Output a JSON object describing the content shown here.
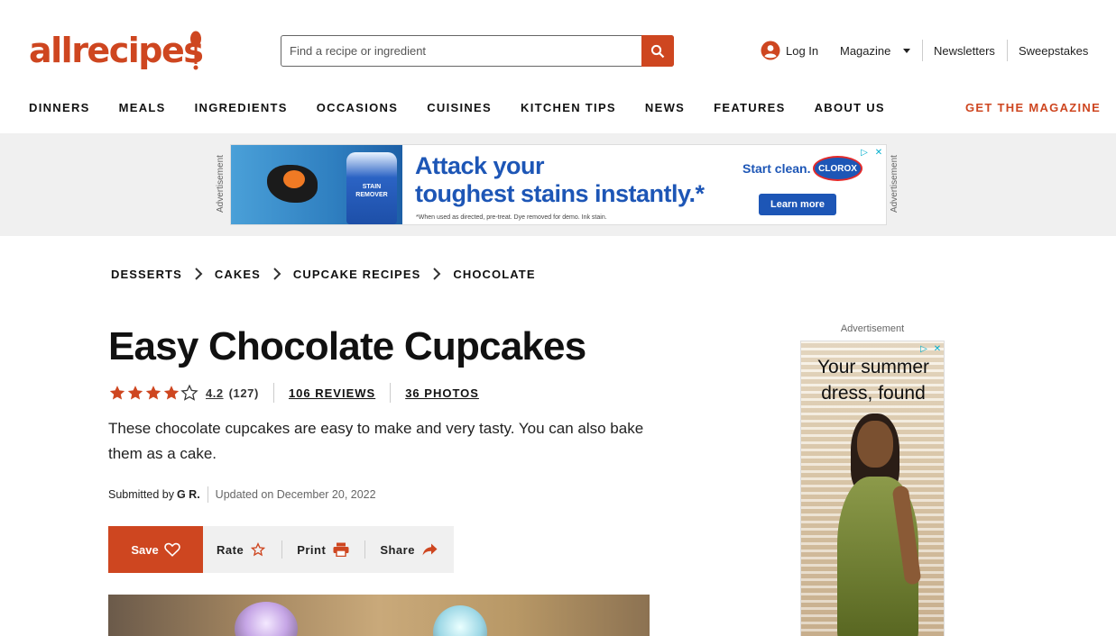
{
  "header": {
    "logo": "allrecipes",
    "search_placeholder": "Find a recipe or ingredient",
    "login": "Log In",
    "magazine": "Magazine",
    "newsletters": "Newsletters",
    "sweepstakes": "Sweepstakes",
    "get_magazine": "GET THE MAGAZINE",
    "accent_color": "#ce4620"
  },
  "nav": [
    "DINNERS",
    "MEALS",
    "INGREDIENTS",
    "OCCASIONS",
    "CUISINES",
    "KITCHEN TIPS",
    "NEWS",
    "FEATURES",
    "ABOUT US"
  ],
  "top_ad": {
    "label": "Advertisement",
    "headline_line1": "Attack your",
    "headline_line2": "toughest stains instantly.*",
    "fine_print": "*When used as directed, pre-treat. Dye removed for demo. Ink stain.",
    "start_clean": "Start clean.",
    "brand": "CLOROX",
    "cta": "Learn more",
    "bottle_label": "STAIN REMOVER"
  },
  "breadcrumb": [
    "DESSERTS",
    "CAKES",
    "CUPCAKE RECIPES",
    "CHOCOLATE"
  ],
  "recipe": {
    "title": "Easy Chocolate Cupcakes",
    "rating": "4.2",
    "rating_count": "(127)",
    "stars_filled": 4,
    "stars_total": 5,
    "reviews": "106 REVIEWS",
    "photos": "36 PHOTOS",
    "description": "These chocolate cupcakes are easy to make and very tasty. You can also bake them as a cake.",
    "submitted_prefix": "Submitted by",
    "author": "G R.",
    "updated": "Updated on December 20, 2022"
  },
  "actions": {
    "save": "Save",
    "rate": "Rate",
    "print": "Print",
    "share": "Share"
  },
  "side_ad": {
    "label": "Advertisement",
    "text": "Your summer dress, found"
  }
}
